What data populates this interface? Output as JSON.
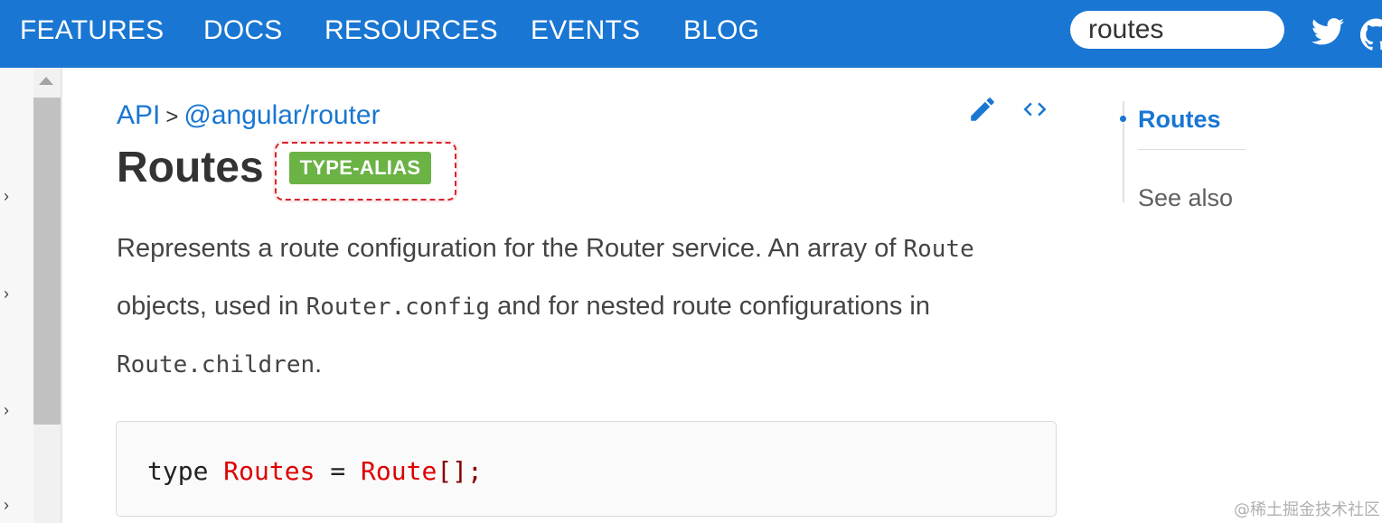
{
  "nav": {
    "items": [
      "FEATURES",
      "DOCS",
      "RESOURCES",
      "EVENTS",
      "BLOG"
    ]
  },
  "search": {
    "value": "routes"
  },
  "icons": {
    "twitter": "twitter-icon",
    "github": "github-icon",
    "edit": "pencil-edit-icon",
    "source": "code-brackets-icon"
  },
  "breadcrumb": {
    "root": "API",
    "separator": ">",
    "package": "@angular/router"
  },
  "page": {
    "title": "Routes",
    "badge": "TYPE-ALIAS",
    "description": {
      "part1": "Represents a route configuration for the Router service. An array of ",
      "code1": "Route",
      "part2": "objects, used in ",
      "code2": "Router.config",
      "part3": " and for nested route configurations in",
      "code3": "Route.children",
      "part4": "."
    },
    "code": {
      "keyword": "type",
      "name": "Routes",
      "equals": "=",
      "type_name": "Route",
      "suffix": "[];"
    }
  },
  "toc": {
    "items": [
      "Routes",
      "See also"
    ]
  },
  "watermark": "@稀土掘金技术社区",
  "colors": {
    "header": "#1976d2",
    "link": "#1976d2",
    "badge": "#6ab344",
    "highlight": "#d9242a"
  }
}
